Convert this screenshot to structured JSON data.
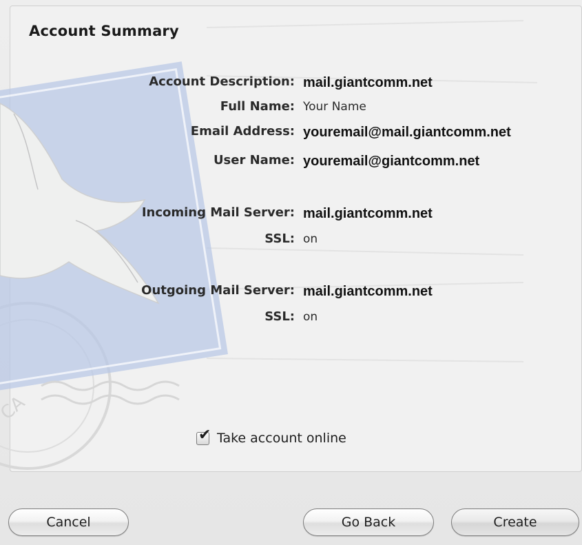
{
  "panel": {
    "title": "Account Summary"
  },
  "summary": {
    "account_description": {
      "label": "Account Description:",
      "value": "mail.giantcomm.net"
    },
    "full_name": {
      "label": "Full Name:",
      "value": "Your Name"
    },
    "email_address": {
      "label": "Email Address:",
      "value": "youremail@mail.giantcomm.net"
    },
    "user_name": {
      "label": "User Name:",
      "value": "youremail@giantcomm.net"
    },
    "incoming_server": {
      "label": "Incoming Mail Server:",
      "value": "mail.giantcomm.net"
    },
    "incoming_ssl": {
      "label": "SSL:",
      "value": "on"
    },
    "outgoing_server": {
      "label": "Outgoing Mail Server:",
      "value": "mail.giantcomm.net"
    },
    "outgoing_ssl": {
      "label": "SSL:",
      "value": "on"
    }
  },
  "options": {
    "take_online_label": "Take account online",
    "take_online_checked": true
  },
  "buttons": {
    "cancel": "Cancel",
    "go_back": "Go Back",
    "create": "Create"
  },
  "icons": {
    "watermark": "mail-stamp-eagle-icon",
    "checkmark": "checkmark-icon"
  }
}
